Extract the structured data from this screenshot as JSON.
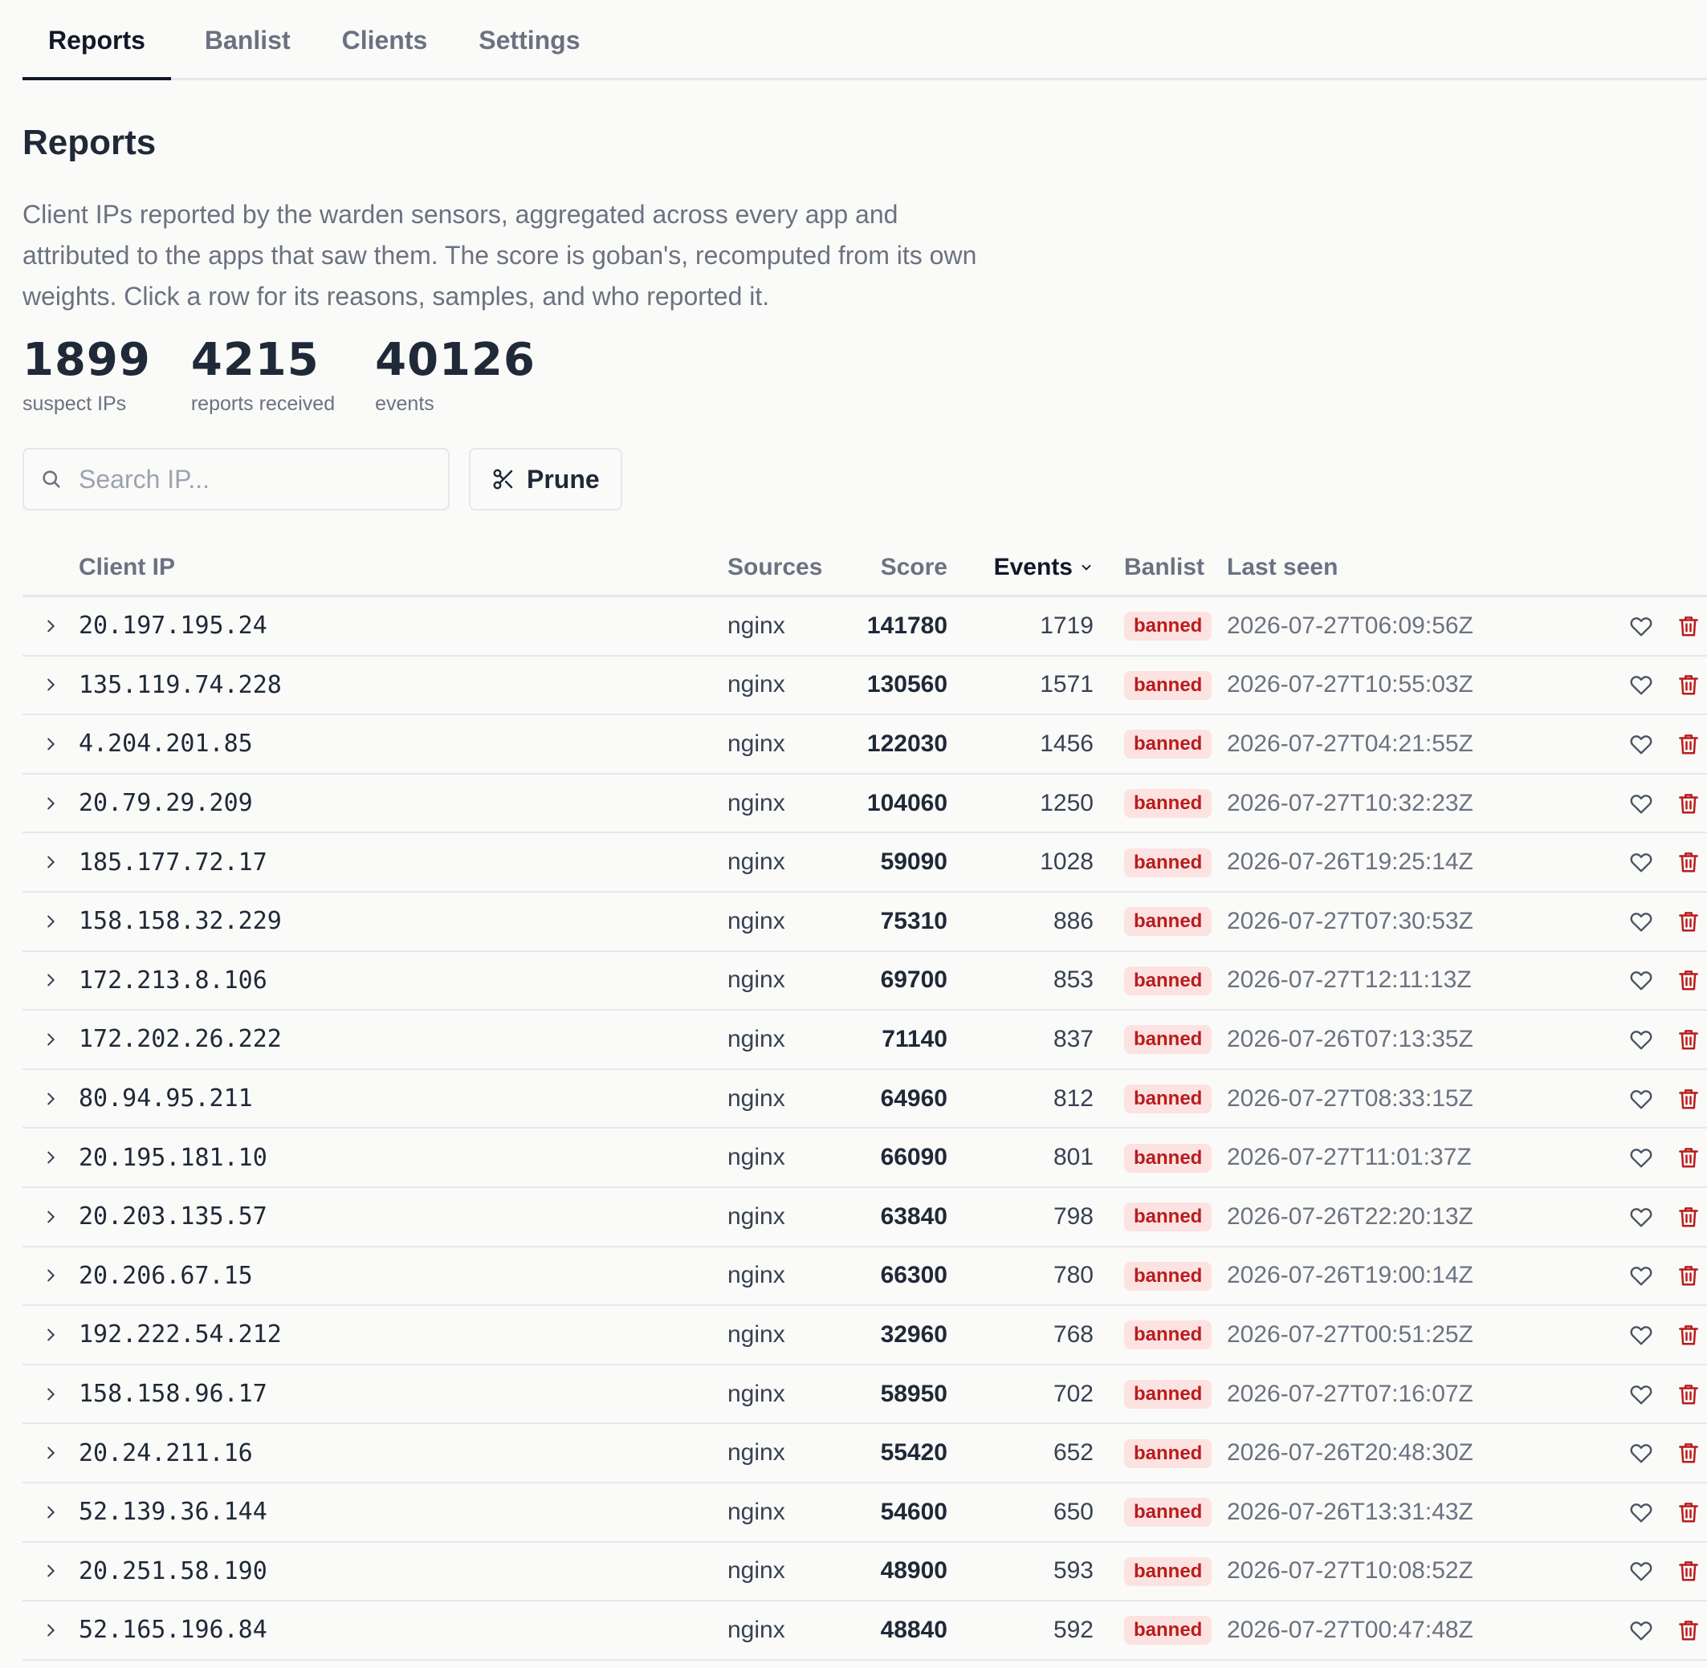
{
  "tabs": [
    {
      "label": "Reports",
      "active": true
    },
    {
      "label": "Banlist",
      "active": false
    },
    {
      "label": "Clients",
      "active": false
    },
    {
      "label": "Settings",
      "active": false
    }
  ],
  "page": {
    "title": "Reports",
    "description": "Client IPs reported by the warden sensors, aggregated across every app and attributed to the apps that saw them. The score is goban's, recomputed from its own weights. Click a row for its reasons, samples, and who reported it."
  },
  "stats": [
    {
      "value": "1899",
      "label": "suspect IPs"
    },
    {
      "value": "4215",
      "label": "reports received"
    },
    {
      "value": "40126",
      "label": "events"
    }
  ],
  "search": {
    "placeholder": "Search IP...",
    "value": ""
  },
  "prune_label": "Prune",
  "table": {
    "columns": {
      "ip": "Client IP",
      "sources": "Sources",
      "score": "Score",
      "events": "Events",
      "banlist": "Banlist",
      "last_seen": "Last seen"
    },
    "sorted_by": "Events",
    "rows": [
      {
        "ip": "20.197.195.24",
        "sources": "nginx",
        "score": "141780",
        "events": "1719",
        "banlist": "banned",
        "last_seen": "2026-07-27T06:09:56Z"
      },
      {
        "ip": "135.119.74.228",
        "sources": "nginx",
        "score": "130560",
        "events": "1571",
        "banlist": "banned",
        "last_seen": "2026-07-27T10:55:03Z"
      },
      {
        "ip": "4.204.201.85",
        "sources": "nginx",
        "score": "122030",
        "events": "1456",
        "banlist": "banned",
        "last_seen": "2026-07-27T04:21:55Z"
      },
      {
        "ip": "20.79.29.209",
        "sources": "nginx",
        "score": "104060",
        "events": "1250",
        "banlist": "banned",
        "last_seen": "2026-07-27T10:32:23Z"
      },
      {
        "ip": "185.177.72.17",
        "sources": "nginx",
        "score": "59090",
        "events": "1028",
        "banlist": "banned",
        "last_seen": "2026-07-26T19:25:14Z"
      },
      {
        "ip": "158.158.32.229",
        "sources": "nginx",
        "score": "75310",
        "events": "886",
        "banlist": "banned",
        "last_seen": "2026-07-27T07:30:53Z"
      },
      {
        "ip": "172.213.8.106",
        "sources": "nginx",
        "score": "69700",
        "events": "853",
        "banlist": "banned",
        "last_seen": "2026-07-27T12:11:13Z"
      },
      {
        "ip": "172.202.26.222",
        "sources": "nginx",
        "score": "71140",
        "events": "837",
        "banlist": "banned",
        "last_seen": "2026-07-26T07:13:35Z"
      },
      {
        "ip": "80.94.95.211",
        "sources": "nginx",
        "score": "64960",
        "events": "812",
        "banlist": "banned",
        "last_seen": "2026-07-27T08:33:15Z"
      },
      {
        "ip": "20.195.181.10",
        "sources": "nginx",
        "score": "66090",
        "events": "801",
        "banlist": "banned",
        "last_seen": "2026-07-27T11:01:37Z"
      },
      {
        "ip": "20.203.135.57",
        "sources": "nginx",
        "score": "63840",
        "events": "798",
        "banlist": "banned",
        "last_seen": "2026-07-26T22:20:13Z"
      },
      {
        "ip": "20.206.67.15",
        "sources": "nginx",
        "score": "66300",
        "events": "780",
        "banlist": "banned",
        "last_seen": "2026-07-26T19:00:14Z"
      },
      {
        "ip": "192.222.54.212",
        "sources": "nginx",
        "score": "32960",
        "events": "768",
        "banlist": "banned",
        "last_seen": "2026-07-27T00:51:25Z"
      },
      {
        "ip": "158.158.96.17",
        "sources": "nginx",
        "score": "58950",
        "events": "702",
        "banlist": "banned",
        "last_seen": "2026-07-27T07:16:07Z"
      },
      {
        "ip": "20.24.211.16",
        "sources": "nginx",
        "score": "55420",
        "events": "652",
        "banlist": "banned",
        "last_seen": "2026-07-26T20:48:30Z"
      },
      {
        "ip": "52.139.36.144",
        "sources": "nginx",
        "score": "54600",
        "events": "650",
        "banlist": "banned",
        "last_seen": "2026-07-26T13:31:43Z"
      },
      {
        "ip": "20.251.58.190",
        "sources": "nginx",
        "score": "48900",
        "events": "593",
        "banlist": "banned",
        "last_seen": "2026-07-27T10:08:52Z"
      },
      {
        "ip": "52.165.196.84",
        "sources": "nginx",
        "score": "48840",
        "events": "592",
        "banlist": "banned",
        "last_seen": "2026-07-27T00:47:48Z"
      }
    ]
  },
  "icons": {
    "search": "search-icon",
    "prune": "scissors-icon",
    "expand": "chevron-right-icon",
    "sort": "chevron-down-icon",
    "allow": "heart-icon",
    "delete": "trash-icon"
  },
  "colors": {
    "badge_bg": "#fde2e2",
    "badge_text": "#b91c1c",
    "delete_icon": "#b91c1c",
    "active_tab": "#111827"
  }
}
